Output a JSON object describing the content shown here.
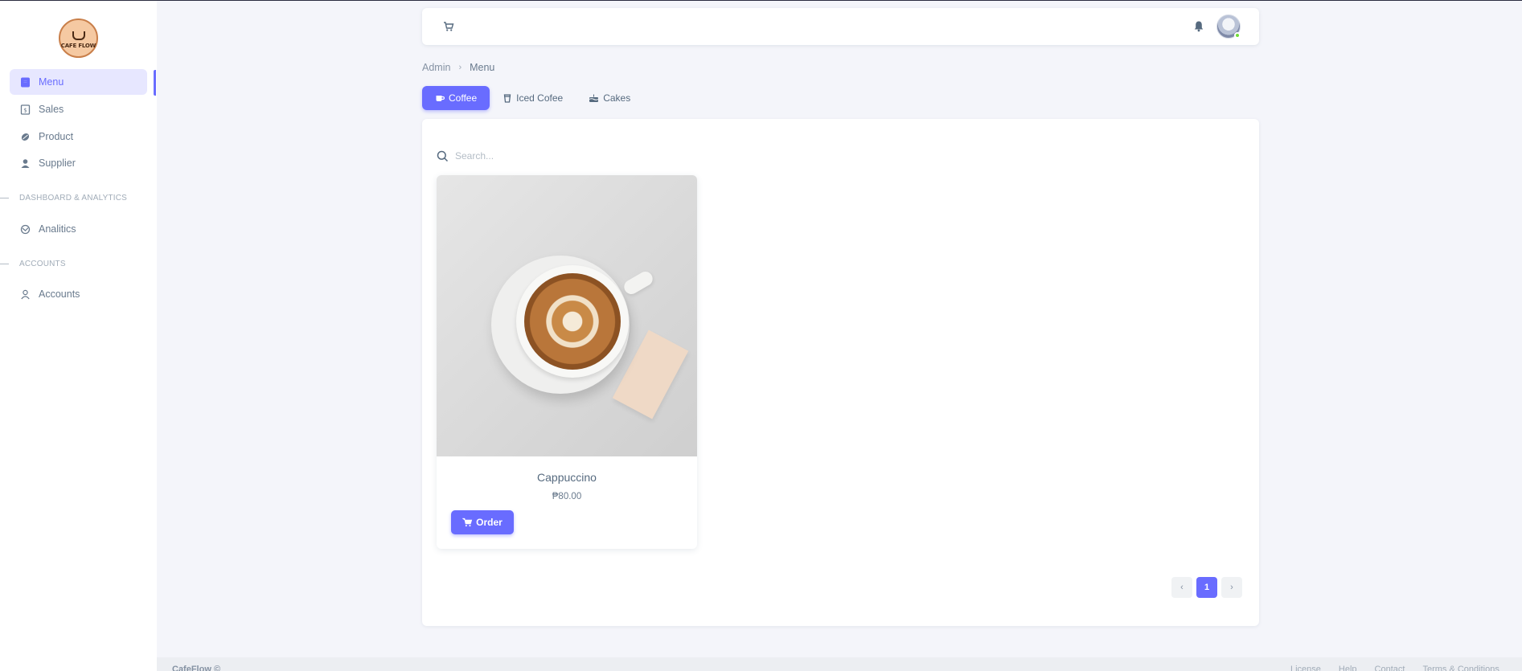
{
  "app": {
    "logo_text": "CAFE FLOW"
  },
  "sidebar": {
    "items": [
      {
        "label": "Menu",
        "icon": "menu-book-icon",
        "active": true
      },
      {
        "label": "Sales",
        "icon": "receipt-icon"
      },
      {
        "label": "Product",
        "icon": "coffee-bean-icon"
      },
      {
        "label": "Supplier",
        "icon": "user-icon"
      }
    ],
    "section1": "DASHBOARD & ANALYTICS",
    "analytics_label": "Analitics",
    "section2": "ACCOUNTS",
    "accounts_label": "Accounts"
  },
  "navbar": {
    "cart_icon": "cart-icon",
    "bell_icon": "bell-icon"
  },
  "breadcrumb": {
    "root": "Admin",
    "separator": "›",
    "current": "Menu"
  },
  "tabs": [
    {
      "label": "Coffee",
      "icon": "coffee-cup-icon",
      "active": true
    },
    {
      "label": "Iced Cofee",
      "icon": "iced-cup-icon"
    },
    {
      "label": "Cakes",
      "icon": "cake-icon"
    }
  ],
  "search": {
    "placeholder": "Search...",
    "value": ""
  },
  "products": [
    {
      "name": "Cappuccino",
      "price": "₱80.00",
      "button": "Order"
    }
  ],
  "pagination": {
    "prev": "‹",
    "current": "1",
    "next": "›"
  },
  "footer": {
    "brand": "CafeFlow ©",
    "links": [
      "License",
      "Help",
      "Contact",
      "Terms & Conditions"
    ]
  },
  "colors": {
    "accent": "#696cff",
    "accent_light": "#e7e7ff",
    "text": "#566a7f",
    "background": "#f4f5fa"
  }
}
